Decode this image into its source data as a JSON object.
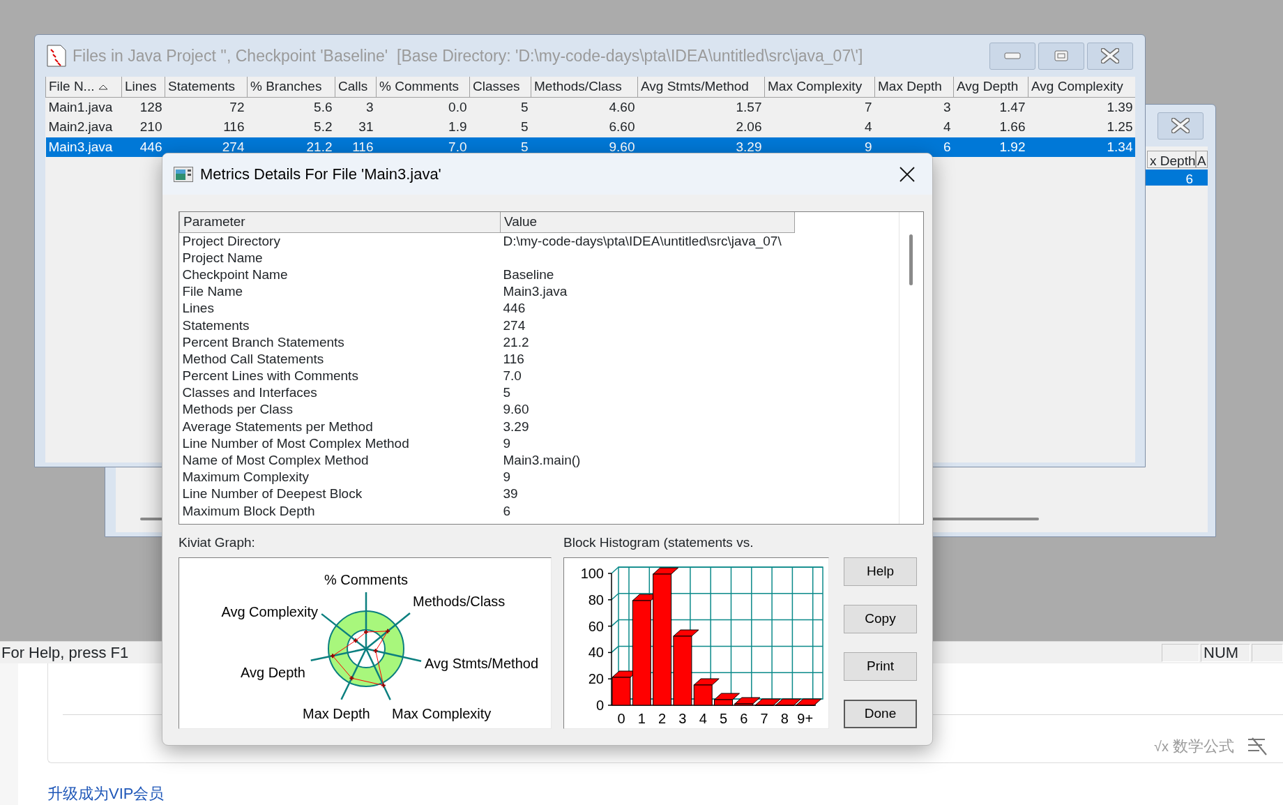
{
  "main_window": {
    "title": "Files in Java Project '', Checkpoint 'Baseline'  [Base Directory: 'D:\\my-code-days\\pta\\IDEA\\untitled\\src\\java_07\\']",
    "table": {
      "columns": [
        {
          "label": "File N...",
          "sorted": true
        },
        {
          "label": "Lines",
          "sorted": false
        },
        {
          "label": "Statements",
          "sorted": false
        },
        {
          "label": "% Branches",
          "sorted": false
        },
        {
          "label": "Calls",
          "sorted": false
        },
        {
          "label": "% Comments",
          "sorted": false
        },
        {
          "label": "Classes",
          "sorted": false
        },
        {
          "label": "Methods/Class",
          "sorted": false
        },
        {
          "label": "Avg Stmts/Method",
          "sorted": false
        },
        {
          "label": "Max Complexity",
          "sorted": false
        },
        {
          "label": "Max Depth",
          "sorted": false
        },
        {
          "label": "Avg Depth",
          "sorted": false
        },
        {
          "label": "Avg Complexity",
          "sorted": false
        }
      ],
      "rows": [
        {
          "cells": [
            "Main1.java",
            "128",
            "72",
            "5.6",
            "3",
            "0.0",
            "5",
            "4.60",
            "1.57",
            "7",
            "3",
            "1.47",
            "1.39"
          ],
          "selected": false
        },
        {
          "cells": [
            "Main2.java",
            "210",
            "116",
            "5.2",
            "31",
            "1.9",
            "5",
            "6.60",
            "2.06",
            "4",
            "4",
            "1.66",
            "1.25"
          ],
          "selected": false
        },
        {
          "cells": [
            "Main3.java",
            "446",
            "274",
            "21.2",
            "116",
            "7.0",
            "5",
            "9.60",
            "3.29",
            "9",
            "6",
            "1.92",
            "1.34"
          ],
          "selected": true
        }
      ]
    }
  },
  "back_window": {
    "table": {
      "columns": [
        "x Depth",
        "A"
      ],
      "rows": [
        {
          "cells": [
            "6"
          ],
          "selected": true
        }
      ]
    }
  },
  "dialog": {
    "title": "Metrics Details For File 'Main3.java'",
    "parameters": {
      "columns": [
        "Parameter",
        "Value"
      ],
      "rows": [
        {
          "parameter": "Project Directory",
          "value": "D:\\my-code-days\\pta\\IDEA\\untitled\\src\\java_07\\"
        },
        {
          "parameter": "Project Name"
        },
        {
          "parameter": "Checkpoint Name",
          "value": "Baseline"
        },
        {
          "parameter": "File Name",
          "value": "Main3.java"
        },
        {
          "parameter": "Lines",
          "value": "446"
        },
        {
          "parameter": "Statements",
          "value": "274"
        },
        {
          "parameter": "Percent Branch Statements",
          "value": "21.2"
        },
        {
          "parameter": "Method Call Statements",
          "value": "116"
        },
        {
          "parameter": "Percent Lines with Comments",
          "value": "7.0"
        },
        {
          "parameter": "Classes and Interfaces",
          "value": "5"
        },
        {
          "parameter": "Methods per Class",
          "value": "9.60"
        },
        {
          "parameter": "Average Statements per Method",
          "value": "3.29"
        },
        {
          "parameter": "Line Number of Most Complex Method",
          "value": "9"
        },
        {
          "parameter": "Name of Most Complex Method",
          "value": "Main3.main()"
        },
        {
          "parameter": "Maximum Complexity",
          "value": "9"
        },
        {
          "parameter": "Line Number of Deepest Block",
          "value": "39"
        },
        {
          "parameter": "Maximum Block Depth",
          "value": "6"
        }
      ]
    },
    "kiviat": {
      "label": "Kiviat Graph:",
      "axes": [
        "% Comments",
        "Methods/Class",
        "Avg Complexity",
        "Avg Stmts/Method",
        "Avg Depth",
        "Max Depth",
        "Max Complexity"
      ]
    },
    "histogram": {
      "chart_data": {
        "type": "bar",
        "title": "Block Histogram (statements vs.",
        "categories": [
          "0",
          "1",
          "2",
          "3",
          "4",
          "5",
          "6",
          "7",
          "8",
          "9+"
        ],
        "values": [
          21,
          79,
          99,
          52,
          15,
          4,
          1,
          0,
          0,
          0
        ],
        "ylim": [
          0,
          100
        ],
        "grid": true,
        "yticks": [
          0,
          20,
          40,
          60,
          80,
          100
        ]
      }
    },
    "buttons": [
      {
        "label": "Help",
        "default": false
      },
      {
        "label": "Copy",
        "default": false
      },
      {
        "label": "Print",
        "default": false
      },
      {
        "label": "Done",
        "default": true
      }
    ]
  },
  "status_bar": {
    "text": "For Help, press F1",
    "indicators": [
      "NUM"
    ]
  },
  "web_page": {
    "toolbar": [
      {
        "icon": "√x",
        "label": "数学公式"
      }
    ],
    "link": "升级成为VIP会员"
  }
}
